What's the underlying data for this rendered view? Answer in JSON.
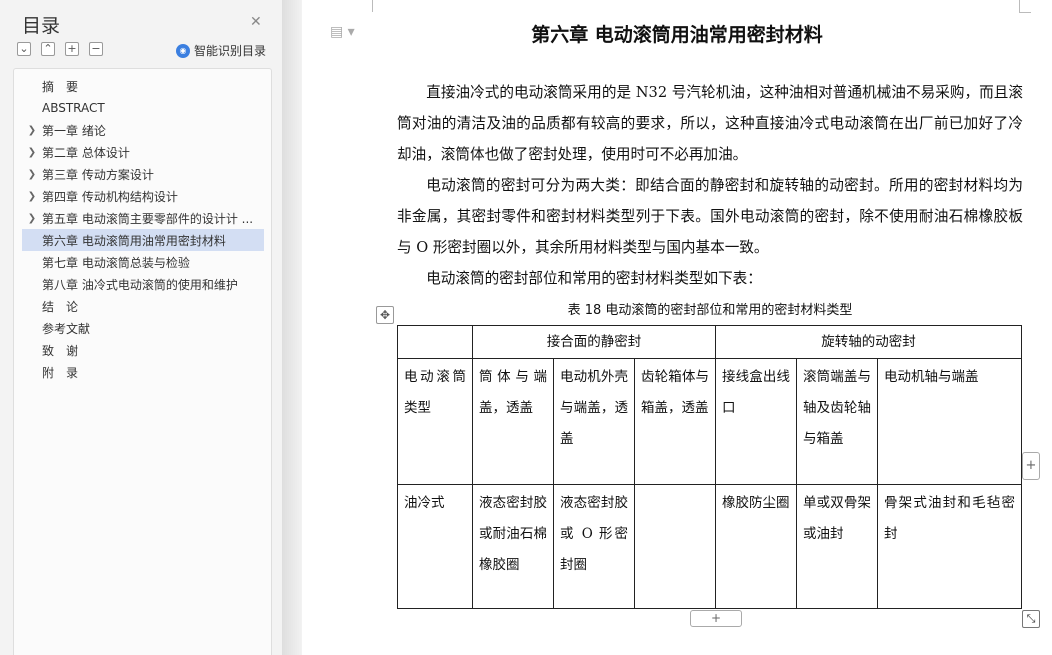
{
  "toc": {
    "title": "目录",
    "ai_label": "智能识别目录",
    "items": [
      {
        "label": "摘　要",
        "arrow": false
      },
      {
        "label": "ABSTRACT",
        "arrow": false
      },
      {
        "label": "第一章  绪论",
        "arrow": true
      },
      {
        "label": "第二章  总体设计",
        "arrow": true
      },
      {
        "label": "第三章  传动方案设计",
        "arrow": true
      },
      {
        "label": "第四章  传动机构结构设计",
        "arrow": true
      },
      {
        "label": "第五章  电动滚筒主要零部件的设计计 ...",
        "arrow": true
      },
      {
        "label": "第六章  电动滚筒用油常用密封材料",
        "arrow": false,
        "active": true
      },
      {
        "label": "第七章  电动滚筒总装与检验",
        "arrow": false
      },
      {
        "label": "第八章  油冷式电动滚筒的使用和维护",
        "arrow": false
      },
      {
        "label": "结　论",
        "arrow": false
      },
      {
        "label": "参考文献",
        "arrow": false
      },
      {
        "label": "致　谢",
        "arrow": false
      },
      {
        "label": "附　录",
        "arrow": false
      }
    ]
  },
  "doc": {
    "title": "第六章  电动滚筒用油常用密封材料",
    "para1": "直接油冷式的电动滚筒采用的是 N32 号汽轮机油，这种油相对普通机械油不易采购，而且滚筒对油的清洁及油的品质都有较高的要求，所以，这种直接油冷式电动滚筒在出厂前已加好了冷却油，滚筒体也做了密封处理，使用时可不必再加油。",
    "para2": "电动滚筒的密封可分为两大类：即结合面的静密封和旋转轴的动密封。所用的密封材料均为非金属，其密封零件和密封材料类型列于下表。国外电动滚筒的密封，除不使用耐油石棉橡胶板与 O 形密封圈以外，其余所用材料类型与国内基本一致。",
    "para3": "电动滚筒的密封部位和常用的密封材料类型如下表：",
    "caption": "表 18  电动滚筒的密封部位和常用的密封材料类型",
    "table": {
      "static_header": "接合面的静密封",
      "dynamic_header": "旋转轴的动密封",
      "row1_label": "电动滚筒类型",
      "row1": [
        "筒体与端盖，透盖",
        "电动机外壳与端盖，透盖",
        "齿轮箱体与箱盖，透盖",
        "接线盒出线口",
        "滚筒端盖与轴及齿轮轴与箱盖",
        "电动机轴与端盖"
      ],
      "row2_label": "油冷式",
      "row2": [
        "液态密封胶或耐油石棉橡胶圈",
        "液态密封胶或 O 形密封圈",
        "",
        "橡胶防尘圈",
        "单或双骨架或油封",
        "骨架式油封和毛毡密封"
      ]
    }
  }
}
